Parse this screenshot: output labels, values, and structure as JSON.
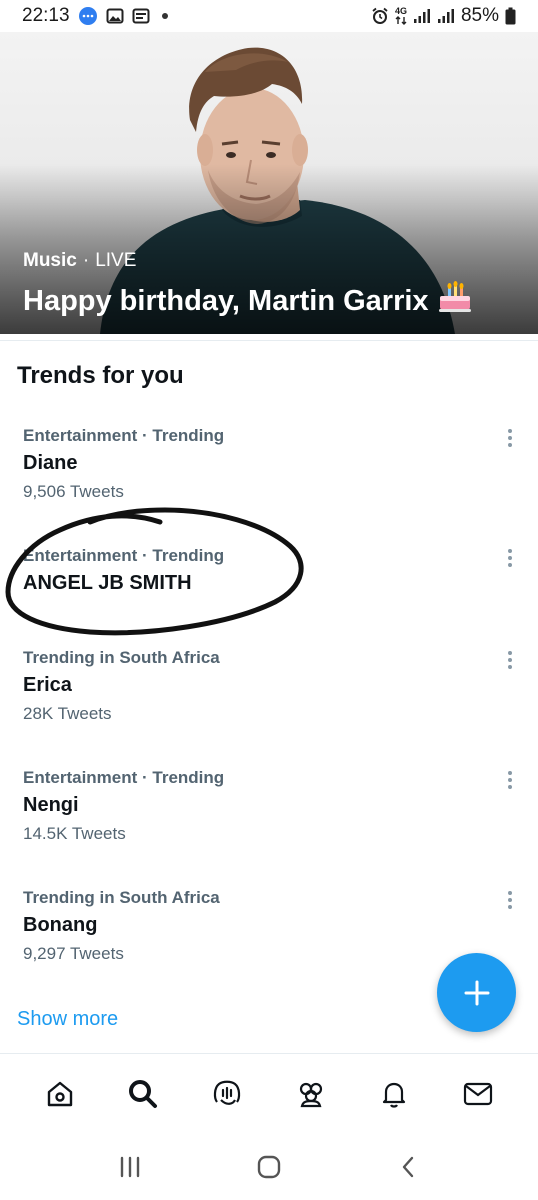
{
  "status_bar": {
    "time": "22:13",
    "network": "4G",
    "battery": "85%",
    "left_icons": [
      "messages-icon",
      "gallery-icon",
      "news-icon",
      "dot-icon"
    ],
    "right_icons": [
      "alarm-icon",
      "network-arrows-icon",
      "signal-icon",
      "signal-icon",
      "battery-icon"
    ]
  },
  "hero": {
    "category": "Music",
    "separator": "·",
    "status": "LIVE",
    "title": "Happy birthday, Martin Garrix",
    "emoji_icon": "birthday-cake-icon"
  },
  "section_title": "Trends for you",
  "trends": [
    {
      "context": "Entertainment · Trending",
      "name": "Diane",
      "count": "9,506 Tweets"
    },
    {
      "context": "Entertainment · Trending",
      "name": "ANGEL JB SMITH",
      "count": ""
    },
    {
      "context": "Trending in South Africa",
      "name": "Erica",
      "count": "28K Tweets"
    },
    {
      "context": "Entertainment · Trending",
      "name": "Nengi",
      "count": "14.5K Tweets"
    },
    {
      "context": "Trending in South Africa",
      "name": "Bonang",
      "count": "9,297 Tweets"
    }
  ],
  "show_more": "Show more",
  "fab_icon": "plus-icon",
  "bottom_nav": [
    "home-icon",
    "search-icon",
    "spaces-icon",
    "communities-icon",
    "notifications-icon",
    "messages-icon"
  ],
  "system_nav": [
    "recents-icon",
    "home-button-icon",
    "back-icon"
  ],
  "colors": {
    "accent": "#1d9bf0",
    "text_primary": "#0f1419",
    "text_secondary": "#536471",
    "annotation_ink": "#111111"
  }
}
